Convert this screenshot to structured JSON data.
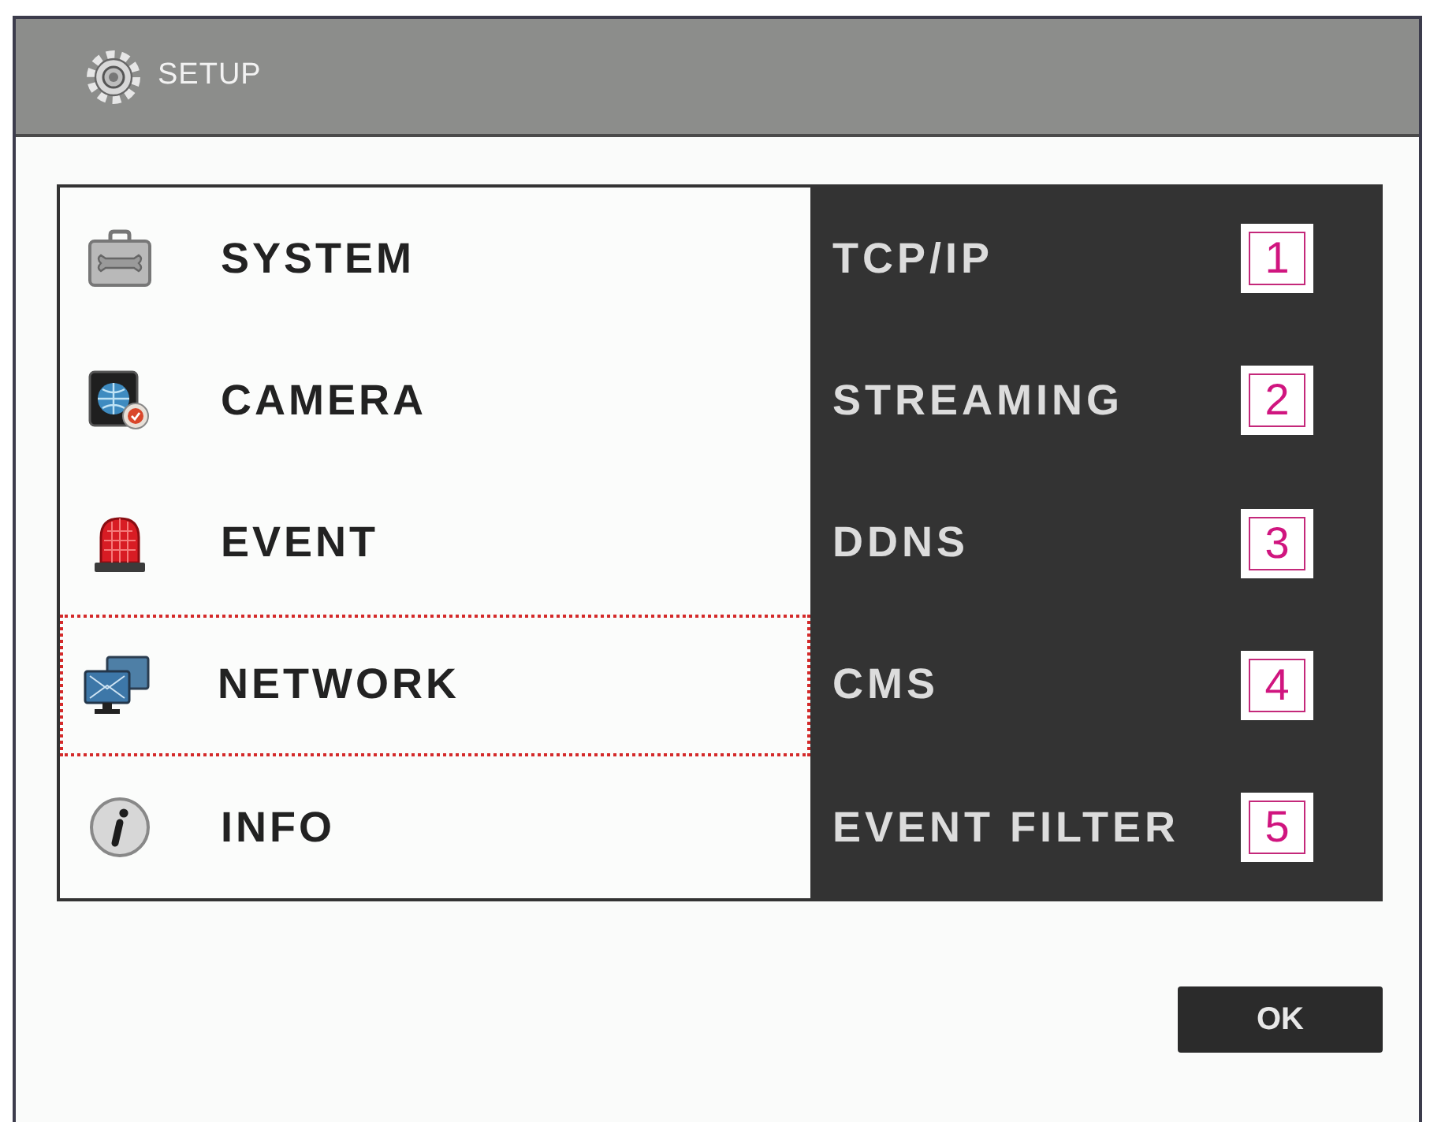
{
  "window": {
    "title": "SETUP"
  },
  "menu": {
    "items": [
      {
        "label": "SYSTEM",
        "selected": false
      },
      {
        "label": "CAMERA",
        "selected": false
      },
      {
        "label": "EVENT",
        "selected": false
      },
      {
        "label": "NETWORK",
        "selected": true
      },
      {
        "label": "INFO",
        "selected": false
      }
    ]
  },
  "submenu": {
    "items": [
      {
        "label": "TCP/IP",
        "callout": "1"
      },
      {
        "label": "STREAMING",
        "callout": "2"
      },
      {
        "label": "DDNS",
        "callout": "3"
      },
      {
        "label": "CMS",
        "callout": "4"
      },
      {
        "label": "EVENT FILTER",
        "callout": "5"
      }
    ]
  },
  "buttons": [
    {
      "label": "OK"
    }
  ]
}
